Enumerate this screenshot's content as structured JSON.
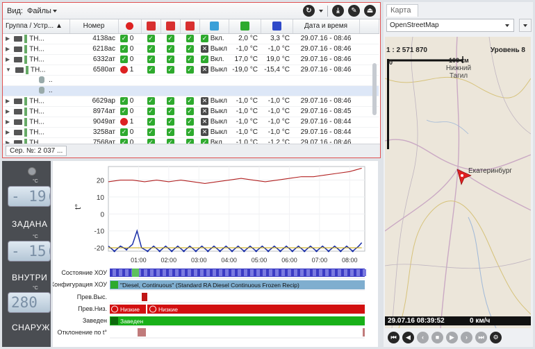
{
  "toolbar": {
    "view_label": "Вид:",
    "files_label": "Файлы"
  },
  "table": {
    "col_group": "Группа / Устр...",
    "col_number": "Номер",
    "col_datetime": "Дата и время",
    "rows": [
      {
        "name": "ТН...",
        "num": "4138ас",
        "alarm": "0",
        "state": "Вкл.",
        "t1": "2,0 °C",
        "t2": "3,3 °C",
        "dt": "29.07.16 - 08:46"
      },
      {
        "name": "ТН...",
        "num": "6218ас",
        "alarm": "0",
        "state": "Выкл",
        "t1": "-1,0 °C",
        "t2": "-1,0 °C",
        "dt": "29.07.16 - 08:46"
      },
      {
        "name": "ТН...",
        "num": "6332ат",
        "alarm": "0",
        "state": "Вкл.",
        "t1": "17,0 °C",
        "t2": "19,0 °C",
        "dt": "29.07.16 - 08:46"
      },
      {
        "name": "ТН...",
        "num": "6580ат",
        "alarm": "1",
        "state": "Выкл",
        "t1": "-19,0 °C",
        "t2": "-15,4 °C",
        "dt": "29.07.16 - 08:46"
      },
      {
        "name": "..",
        "num": "",
        "alarm": "",
        "state": "",
        "t1": "",
        "t2": "",
        "dt": ""
      },
      {
        "name": "..",
        "num": "",
        "alarm": "",
        "state": "",
        "t1": "",
        "t2": "",
        "dt": ""
      },
      {
        "name": "ТН...",
        "num": "6629ар",
        "alarm": "0",
        "state": "Выкл",
        "t1": "-1,0 °C",
        "t2": "-1,0 °C",
        "dt": "29.07.16 - 08:46"
      },
      {
        "name": "ТН...",
        "num": "8974ат",
        "alarm": "0",
        "state": "Выкл",
        "t1": "-1,0 °C",
        "t2": "-1,0 °C",
        "dt": "29.07.16 - 08:45"
      },
      {
        "name": "ТН...",
        "num": "9049ат",
        "alarm": "1",
        "state": "Выкл",
        "t1": "-1,0 °C",
        "t2": "-1,0 °C",
        "dt": "29.07.16 - 08:44"
      },
      {
        "name": "ТН...",
        "num": "3258ат",
        "alarm": "0",
        "state": "Выкл",
        "t1": "-1,0 °C",
        "t2": "-1,0 °C",
        "dt": "29.07.16 - 08:44"
      },
      {
        "name": "ТН...",
        "num": "7568ат",
        "alarm": "0",
        "state": "Вкл.",
        "t1": "-1,0 °C",
        "t2": "-1,2 °C",
        "dt": "29.07.16 - 08:46"
      }
    ]
  },
  "status": {
    "serial": "Сер. №: 2 037 ..."
  },
  "gauges": {
    "g1_value": "- 19(",
    "g1_label": "ЗАДАНА",
    "g2_value": "- 15(",
    "g2_label": "ВНУТРИ",
    "g3_value": "280",
    "g3_label": "СНАРУЖ",
    "unit": "°C"
  },
  "chart_data": {
    "type": "line",
    "ylabel": "t°",
    "yticks": [
      "20",
      "10",
      "0",
      "-10",
      "-20"
    ],
    "ylim": [
      -22,
      28
    ],
    "xticks": [
      "01:00",
      "02:00",
      "03:00",
      "04:00",
      "05:00",
      "06:00",
      "07:00",
      "08:00"
    ],
    "xlim": [
      0.0,
      8.5
    ],
    "series": [
      {
        "name": "",
        "color": "#b22222",
        "x": [
          0.0,
          0.4,
          0.8,
          1.2,
          1.6,
          2.0,
          2.4,
          2.8,
          3.2,
          3.6,
          4.0,
          4.4,
          4.8,
          5.2,
          5.6,
          6.0,
          6.4,
          6.8,
          7.2,
          7.6,
          8.0,
          8.4
        ],
        "y": [
          19,
          20,
          20,
          19,
          20,
          19,
          20,
          19,
          18,
          19,
          20,
          21,
          20,
          19,
          20,
          21,
          22,
          22,
          23,
          24,
          25,
          27
        ]
      },
      {
        "name": "",
        "color": "#1a2fa8",
        "x": [
          0.0,
          0.2,
          0.4,
          0.6,
          0.8,
          0.95,
          1.1,
          1.3,
          1.5,
          1.7,
          1.9,
          2.1,
          2.3,
          2.5,
          2.7,
          2.9,
          3.1,
          3.3,
          3.5,
          3.7,
          3.9,
          4.1,
          4.3,
          4.5,
          4.7,
          4.9,
          5.1,
          5.3,
          5.5,
          5.7,
          5.9,
          6.1,
          6.3,
          6.5,
          6.7,
          6.9,
          7.1,
          7.3,
          7.5,
          7.7,
          7.9,
          8.1,
          8.3,
          8.4
        ],
        "y": [
          -19,
          -22,
          -19,
          -21,
          -18,
          -10,
          -20,
          -22,
          -19,
          -22,
          -19,
          -22,
          -19,
          -22,
          -19,
          -22,
          -19,
          -22,
          -19,
          -22,
          -19,
          -22,
          -19,
          -22,
          -19,
          -22,
          -19,
          -22,
          -19,
          -22,
          -19,
          -22,
          -19,
          -22,
          -19,
          -22,
          -19,
          -22,
          -19,
          -22,
          -19,
          -22,
          -19,
          -17
        ]
      },
      {
        "name": "",
        "color": "#c8a400",
        "x": [
          0.0,
          8.4
        ],
        "y": [
          -20,
          -20
        ]
      }
    ]
  },
  "timeline": {
    "rows": [
      {
        "label": "Состояние ХОУ",
        "text": ""
      },
      {
        "label": "Конфигурация ХОУ",
        "text": "\"Diesel, Continuous\" (Standard RA Diesel Continuous Frozen Recip)"
      },
      {
        "label": "Прев.Выс.",
        "text": ""
      },
      {
        "label": "Прев.Низ.",
        "text": "Низкие",
        "text2": "Низкие"
      },
      {
        "label": "Заведен",
        "text": "Заведен"
      },
      {
        "label": "Отклонение по t°",
        "text": ""
      }
    ]
  },
  "map": {
    "tab": "Карта",
    "provider": "OpenStreetMap",
    "scale": "1 : 2 571 870",
    "level": "Уровень 8",
    "scalebar": "100 км",
    "zero": "0",
    "city1": "Нижний Тагил",
    "city2": "Екатеринбург",
    "timestamp": "29.07.16  08:39:52",
    "speed": "0 км/ч"
  },
  "colors": {
    "check": "#2eaa2e",
    "alarm": "#d22222",
    "header_red": "#cc2222",
    "accent_blue": "#2f49c9"
  }
}
